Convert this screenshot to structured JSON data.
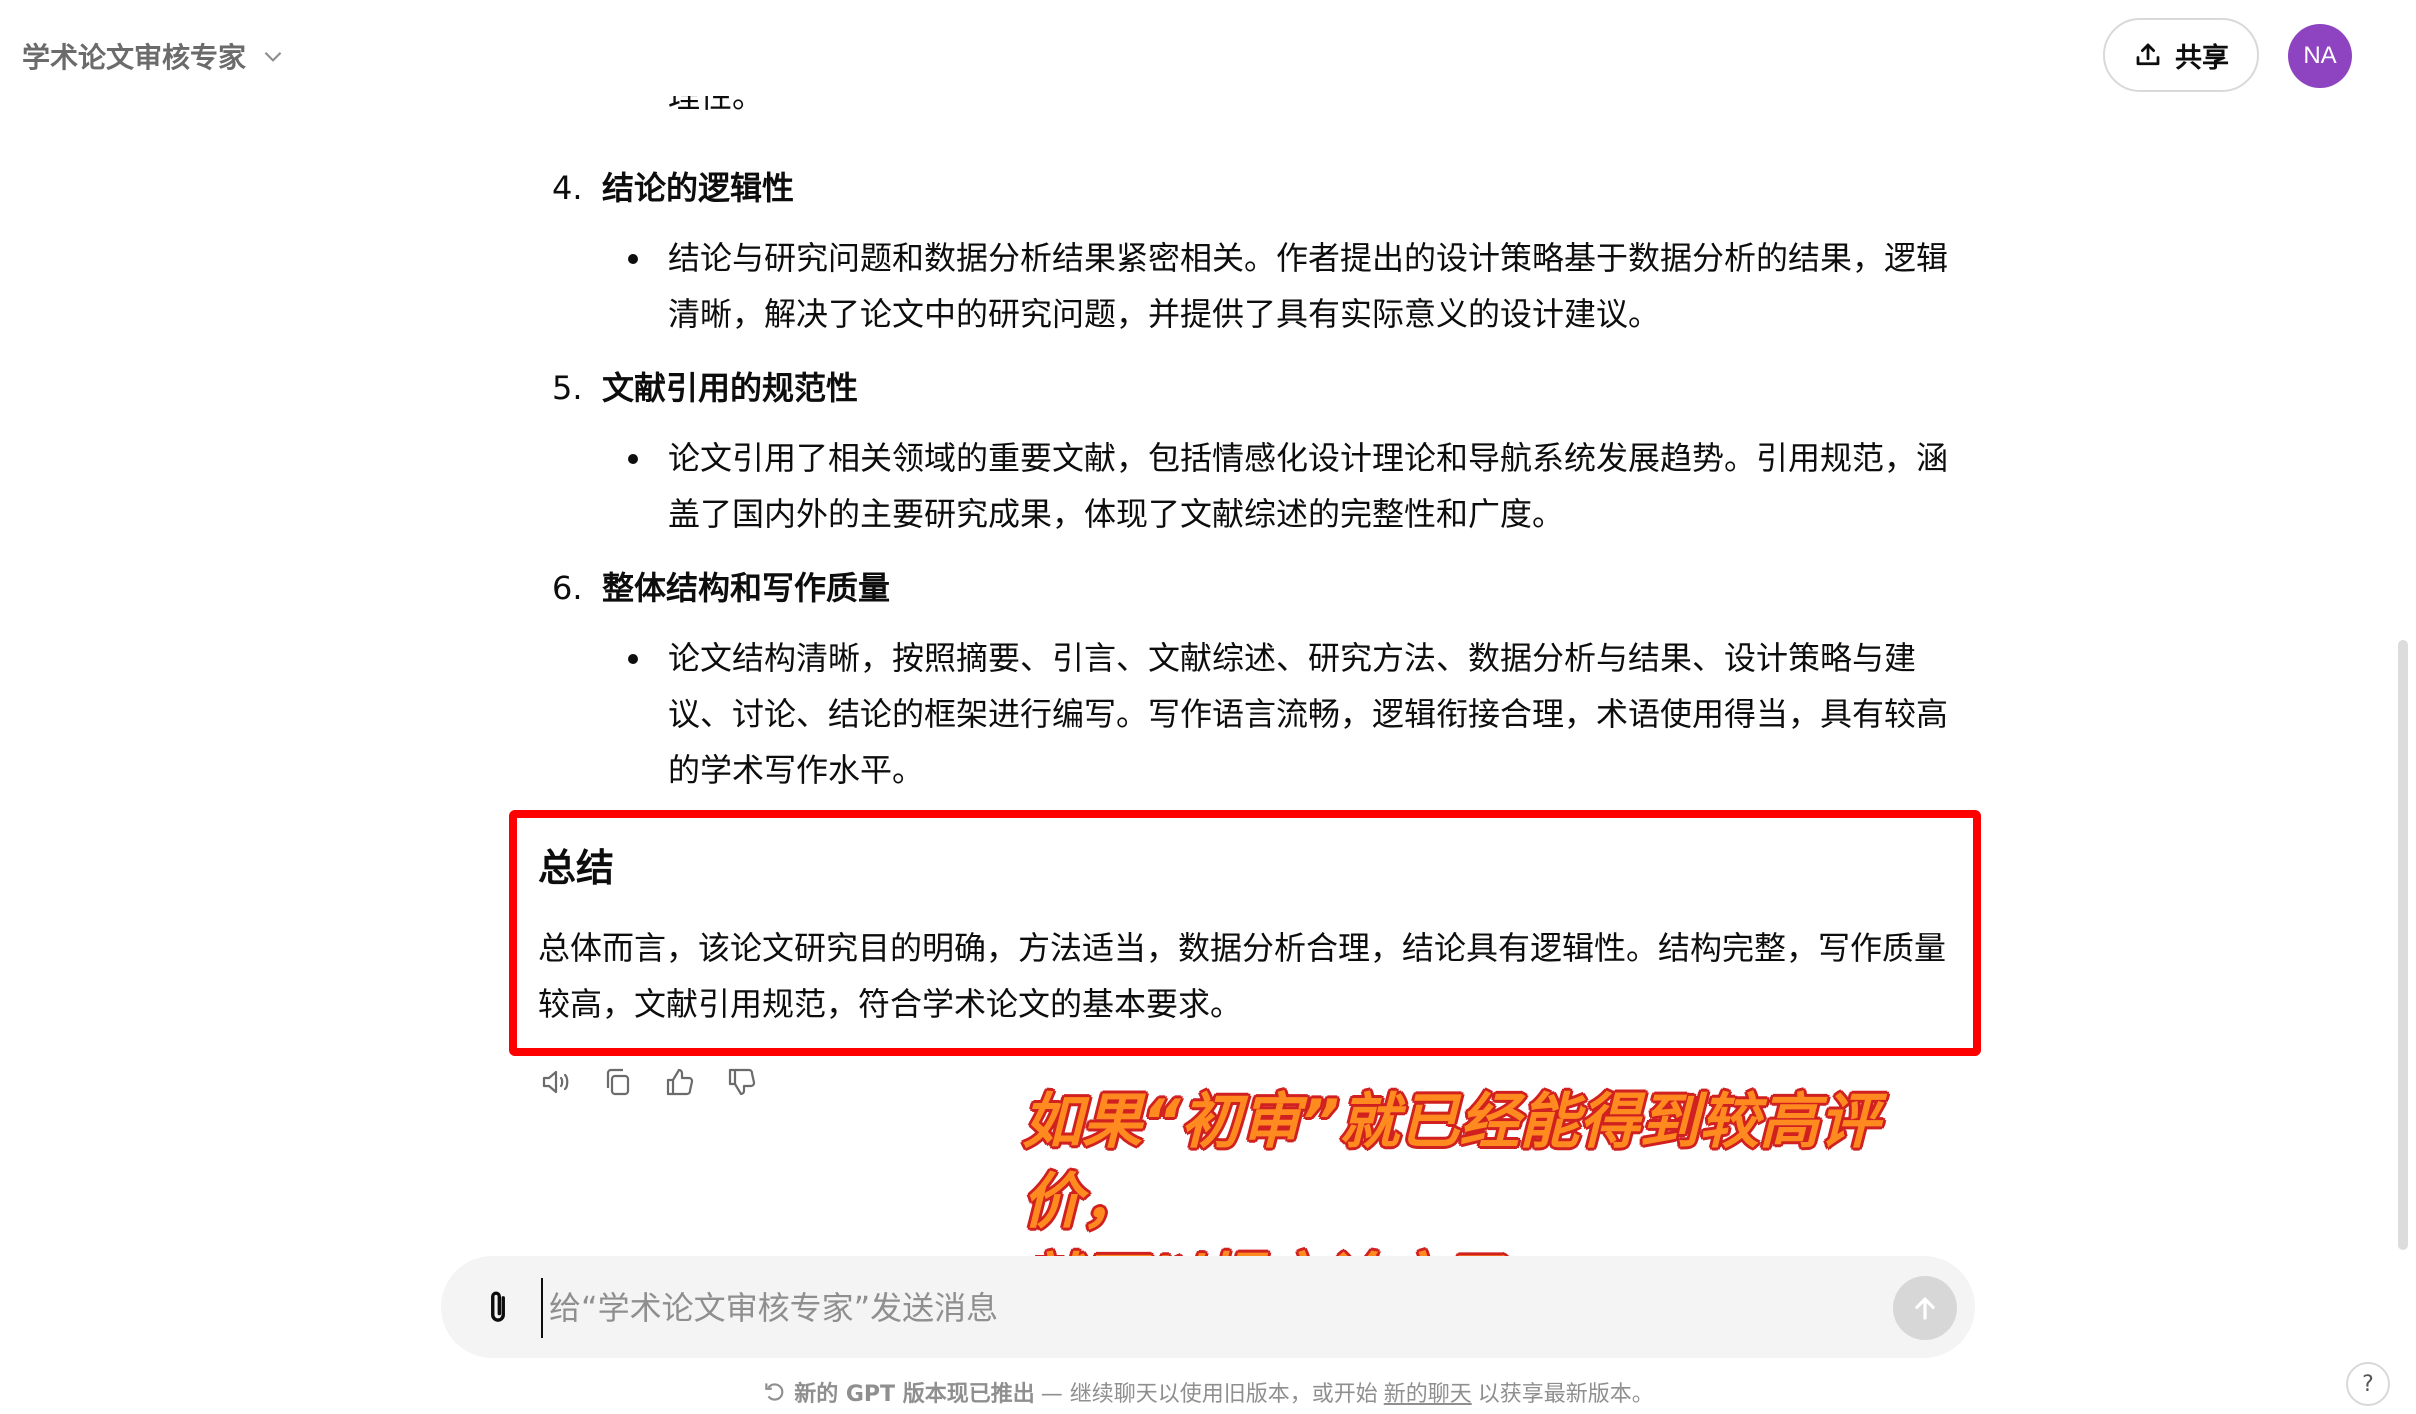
{
  "header": {
    "model_name": "学术论文审核专家",
    "share_label": "共享",
    "avatar_initials": "NA"
  },
  "conversation": {
    "cut_off_text": "理性。",
    "items": [
      {
        "number": "4.",
        "title": "结论的逻辑性",
        "bullet": "结论与研究问题和数据分析结果紧密相关。作者提出的设计策略基于数据分析的结果，逻辑清晰，解决了论文中的研究问题，并提供了具有实际意义的设计建议。"
      },
      {
        "number": "5.",
        "title": "文献引用的规范性",
        "bullet": "论文引用了相关领域的重要文献，包括情感化设计理论和导航系统发展趋势。引用规范，涵盖了国内外的主要研究成果，体现了文献综述的完整性和广度。"
      },
      {
        "number": "6.",
        "title": "整体结构和写作质量",
        "bullet": "论文结构清晰，按照摘要、引言、文献综述、研究方法、数据分析与结果、设计策略与建议、讨论、结论的框架进行编写。写作语言流畅，逻辑衔接合理，术语使用得当，具有较高的学术写作水平。"
      }
    ],
    "summary": {
      "title": "总结",
      "text": "总体而言，该论文研究目的明确，方法适当，数据分析合理，结论具有逻辑性。结构完整，写作质量较高，文献引用规范，符合学术论文的基本要求。"
    }
  },
  "annotation": {
    "line1": "如果“初审”就已经能得到较高评价，",
    "line2": "就可以提交论文了。"
  },
  "composer": {
    "placeholder": "给“学术论文审核专家”发送消息",
    "value": ""
  },
  "footer": {
    "part1": "新的 GPT 版本现已推出",
    "part2": " — 继续聊天以使用旧版本，或开始",
    "link": "新的聊天",
    "part3": "以获享最新版本。"
  },
  "help_label": "?",
  "colors": {
    "highlight_border": "#ff0000",
    "annotation_fill": "#ff8a1f",
    "annotation_outline": "#d02020",
    "avatar_bg": "#8e44c0"
  },
  "icons": [
    "chevron-down-icon",
    "share-upload-icon",
    "read-aloud-icon",
    "copy-icon",
    "thumbs-up-icon",
    "thumbs-down-icon",
    "paperclip-icon",
    "arrow-up-icon",
    "gpt-refresh-icon"
  ]
}
